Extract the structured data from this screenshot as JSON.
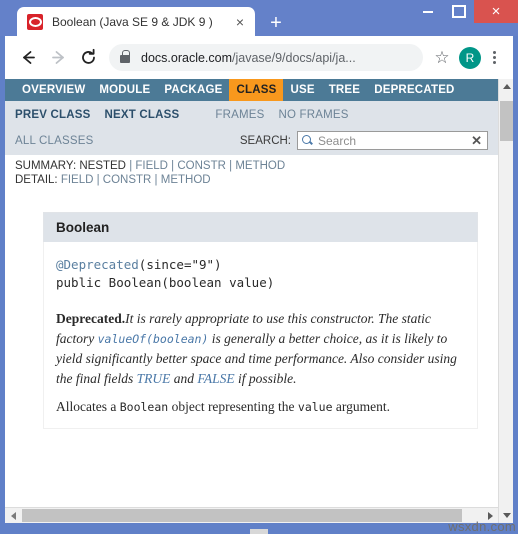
{
  "window": {
    "controls": {
      "minimize": "minimize-button",
      "maximize": "maximize-button",
      "close": "×"
    }
  },
  "tab": {
    "title": "Boolean (Java SE 9 & JDK 9 )",
    "close_label": "×",
    "favicon": "oracle-favicon",
    "newtab_label": "+"
  },
  "toolbar": {
    "back": "back-arrow-icon",
    "forward": "forward-arrow-icon",
    "reload": "reload-icon",
    "url_host": "docs.oracle.com",
    "url_path": "/javase/9/docs/api/ja...",
    "bookmark_label": "☆",
    "profile_initial": "R",
    "menu_label": "browser-menu"
  },
  "javadoc": {
    "navbar": [
      {
        "label": "OVERVIEW",
        "active": false
      },
      {
        "label": "MODULE",
        "active": false
      },
      {
        "label": "PACKAGE",
        "active": false
      },
      {
        "label": "CLASS",
        "active": true
      },
      {
        "label": "USE",
        "active": false
      },
      {
        "label": "TREE",
        "active": false
      },
      {
        "label": "DEPRECATED",
        "active": false
      }
    ],
    "prev_class": "PREV CLASS",
    "next_class": "NEXT CLASS",
    "frames": "FRAMES",
    "no_frames": "NO FRAMES",
    "all_classes": "ALL CLASSES",
    "search": {
      "label": "SEARCH:",
      "placeholder": "Search",
      "value": "",
      "reset_label": "✕"
    },
    "summary": {
      "prefix": "SUMMARY:",
      "items": [
        "NESTED",
        "FIELD",
        "CONSTR",
        "METHOD"
      ],
      "separator": "|"
    },
    "detail": {
      "prefix": "DETAIL:",
      "items": [
        "FIELD",
        "CONSTR",
        "METHOD"
      ],
      "separator": "|"
    }
  },
  "member": {
    "heading": "Boolean",
    "annotation": "@Deprecated",
    "annotation_args": "(since=\"9\")",
    "signature": "public Boolean(boolean value)",
    "deprecated": {
      "label": "Deprecated.",
      "text_1": "It is rarely appropriate to use this constructor. The static factory ",
      "code_link": "valueOf(boolean)",
      "text_2": " is generally a better choice, as it is likely to yield significantly better space and time performance. Also consider using the final fields ",
      "field_true": "TRUE",
      "text_3": " and ",
      "field_false": "FALSE",
      "text_4": " if possible."
    },
    "description": {
      "text_1": "Allocates a ",
      "code_1": "Boolean",
      "text_2": " object representing the ",
      "code_2": "value",
      "text_3": " argument."
    }
  },
  "scrollbars": {
    "v_up": "scroll-up-arrow",
    "v_down": "scroll-down-arrow",
    "h_left": "scroll-left-arrow",
    "h_right": "scroll-right-arrow"
  },
  "watermark": "wsxdn.com",
  "colors": {
    "chrome_frame": "#6481c9",
    "navbar_bg": "#4c7a96",
    "active_tab_bg": "#f8981d",
    "subnav_bg": "#dee3e9",
    "close_btn": "#d9534f",
    "avatar": "#009688",
    "link": "#4a78a8"
  }
}
